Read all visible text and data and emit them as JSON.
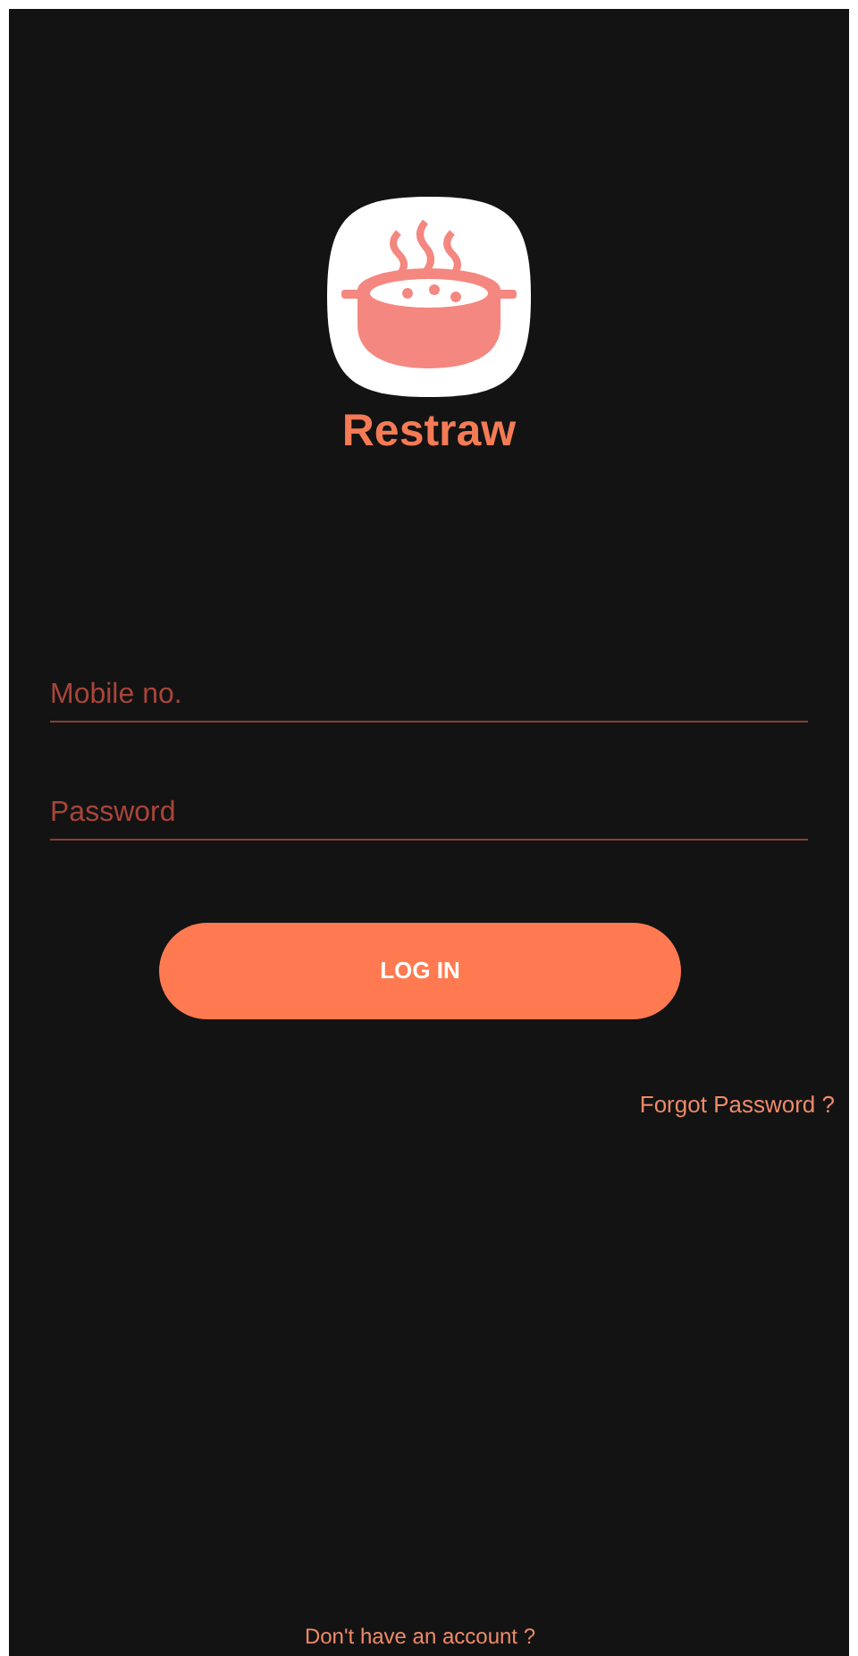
{
  "app": {
    "name": "Restraw"
  },
  "fields": [
    {
      "placeholder": "Mobile no."
    },
    {
      "placeholder": "Password"
    }
  ],
  "login_button": {
    "label": "LOG IN"
  },
  "forgot_link": {
    "label": "Forgot Password ?"
  },
  "signup_link": {
    "label": "Don't have an account ?"
  }
}
